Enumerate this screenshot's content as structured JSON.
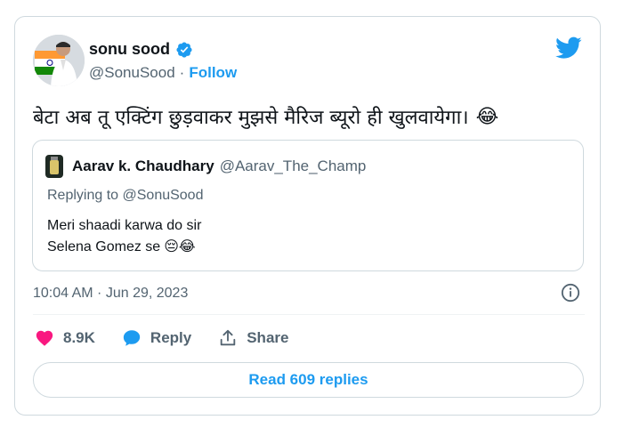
{
  "author": {
    "display_name": "sonu sood",
    "handle": "@SonuSood",
    "separator": "·",
    "follow_label": "Follow"
  },
  "tweet": {
    "text": "बेटा अब तू एक्टिंग छुड़वाकर मुझसे मैरिज ब्यूरो ही खुलवायेगा।",
    "emoji": "😂"
  },
  "quoted": {
    "display_name": "Aarav k. Chaudhary",
    "handle": "@Aarav_The_Champ",
    "replying_prefix": "Replying to",
    "replying_handle": "@SonuSood",
    "line1": "Meri shaadi karwa do sir",
    "line2": "Selena Gomez se",
    "line2_emojis": "😔😂"
  },
  "meta": {
    "timestamp": "10:04 AM · Jun 29, 2023"
  },
  "actions": {
    "like_count": "8.9K",
    "reply_label": "Reply",
    "share_label": "Share",
    "read_replies_label": "Read 609 replies"
  },
  "colors": {
    "accent": "#1d9bf0",
    "like": "#f91880",
    "text": "#0f1419",
    "muted": "#536471",
    "border": "#cfd9de"
  },
  "icons": [
    "verified-badge-icon",
    "twitter-bird-icon",
    "info-icon",
    "heart-icon",
    "reply-bubble-icon",
    "share-icon"
  ]
}
